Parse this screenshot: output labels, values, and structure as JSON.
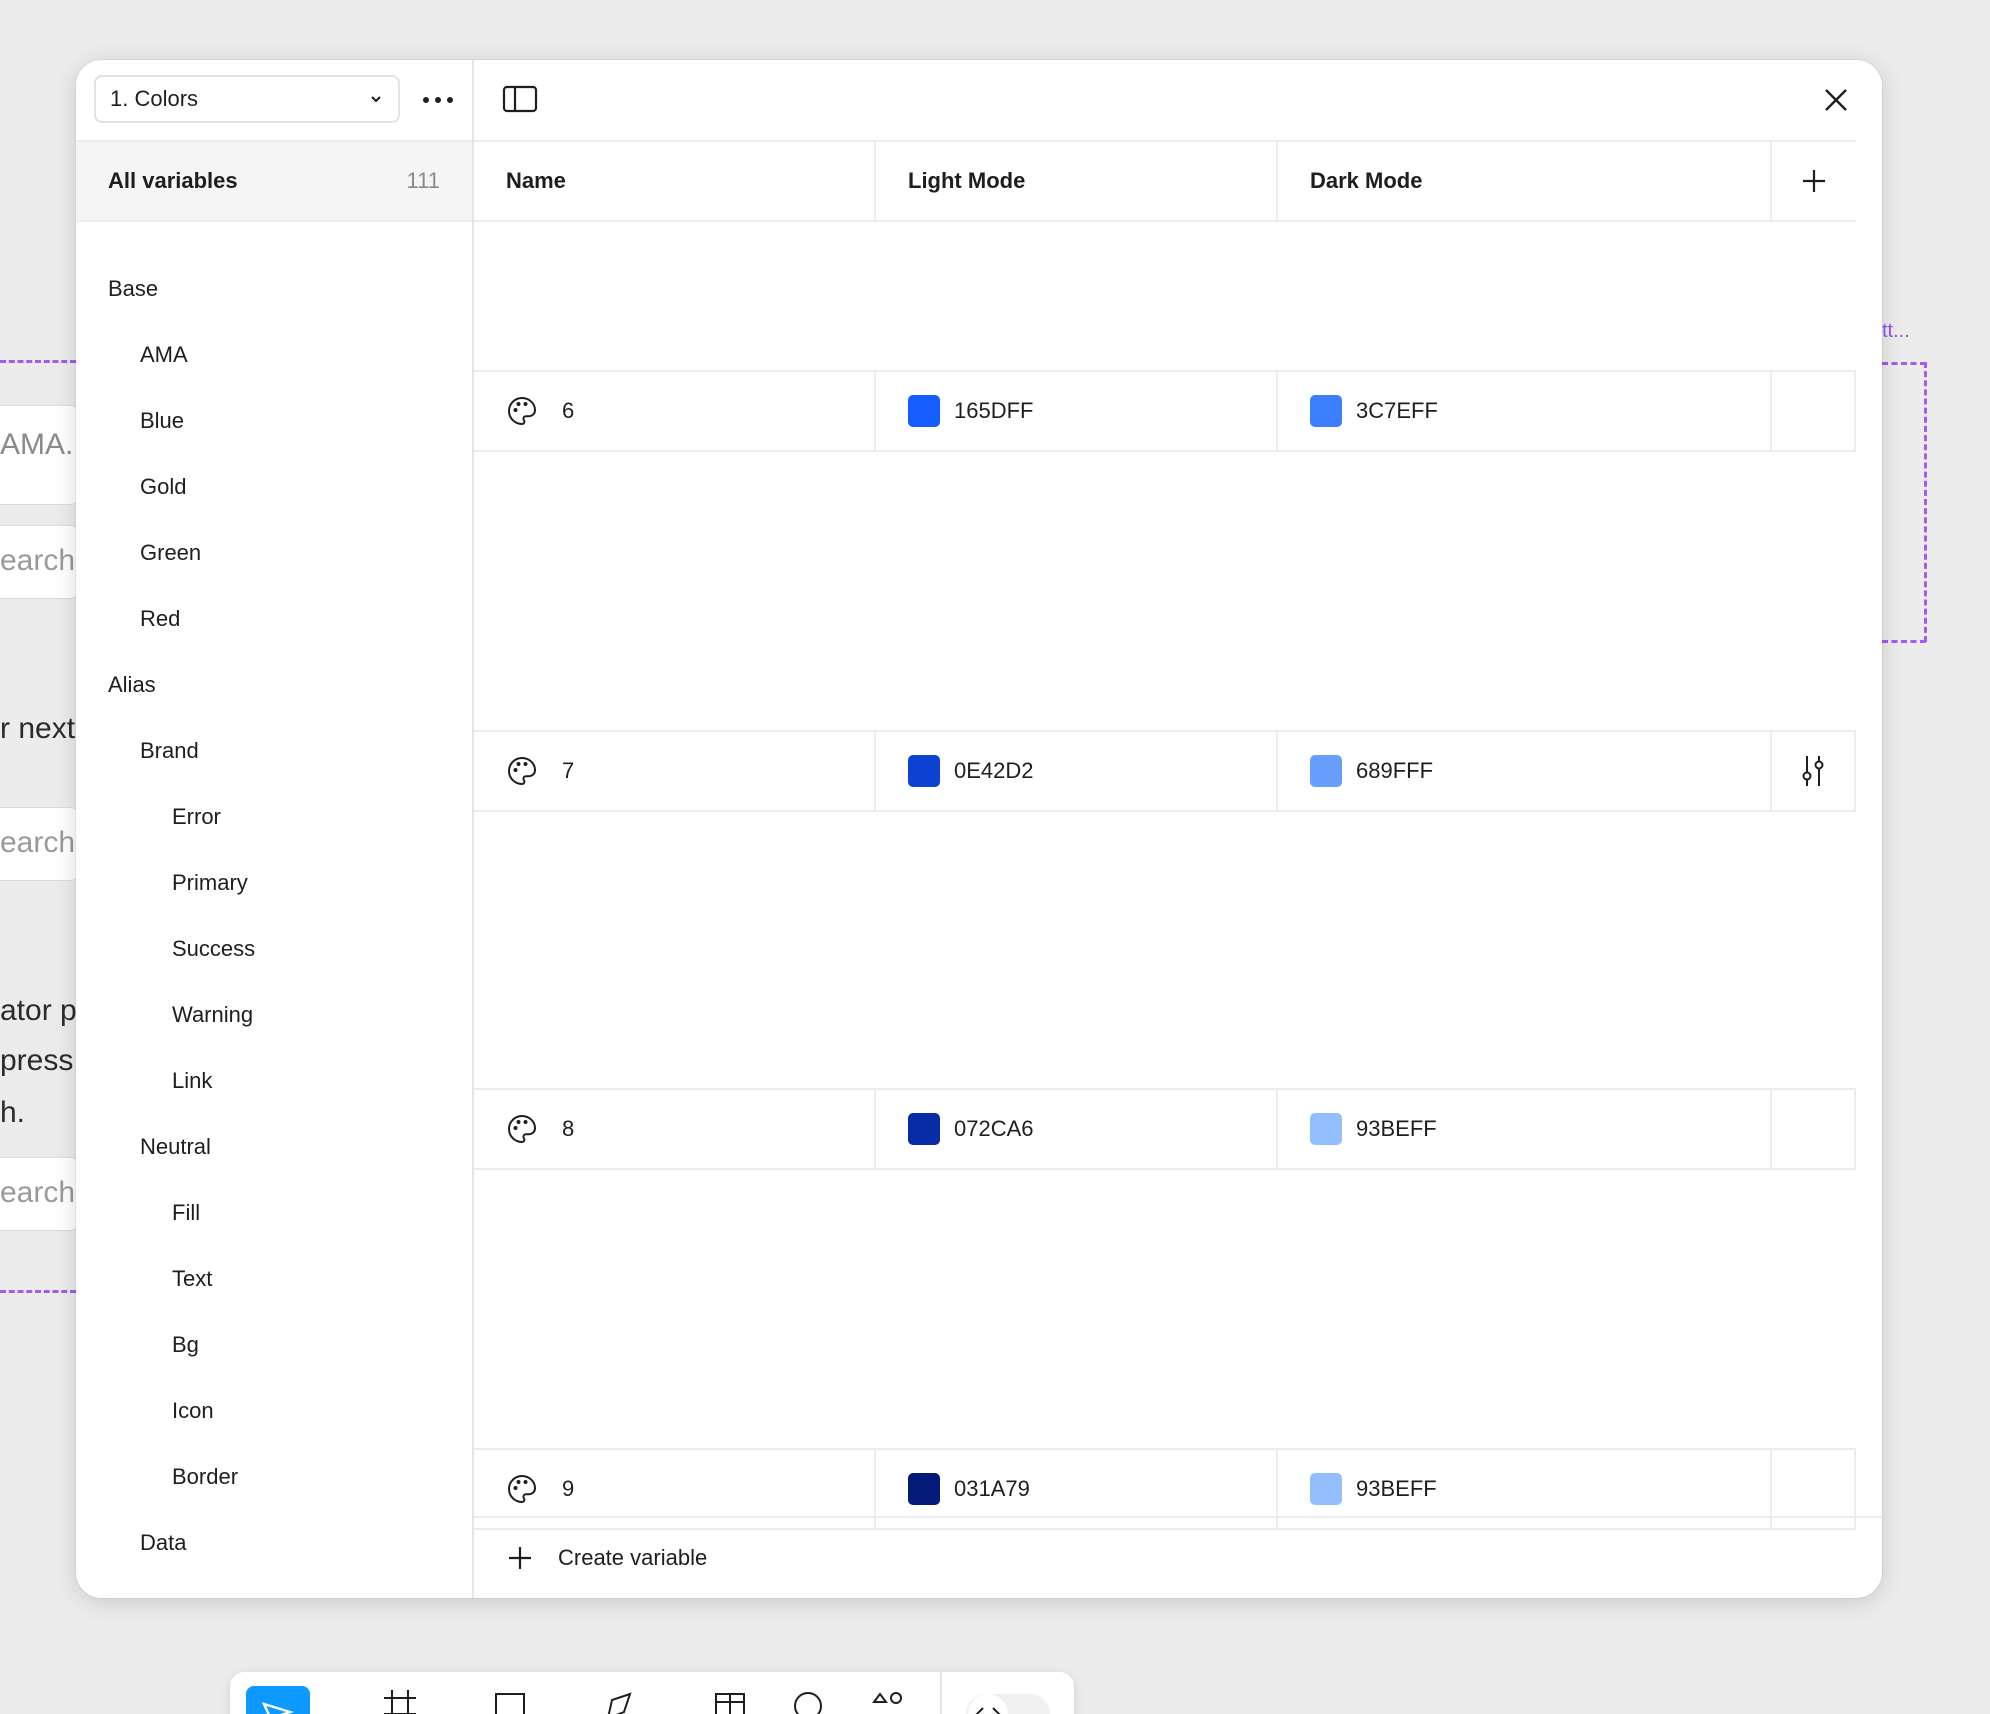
{
  "background": {
    "fragments": {
      "ama": "AMA...",
      "search1": "earch",
      "next": "r next",
      "search2": "earch",
      "ator": "ator p",
      "press": "press",
      "h": "h.",
      "search3": "earch",
      "purple_label": "tt..."
    }
  },
  "sidebar": {
    "collection": "1. Colors",
    "all_variables_label": "All variables",
    "all_variables_count": "111",
    "groups": [
      {
        "label": "Base",
        "level": 0
      },
      {
        "label": "AMA",
        "level": 1
      },
      {
        "label": "Blue",
        "level": 1
      },
      {
        "label": "Gold",
        "level": 1
      },
      {
        "label": "Green",
        "level": 1
      },
      {
        "label": "Red",
        "level": 1
      },
      {
        "label": "Alias",
        "level": 0
      },
      {
        "label": "Brand",
        "level": 1
      },
      {
        "label": "Error",
        "level": 2
      },
      {
        "label": "Primary",
        "level": 2
      },
      {
        "label": "Success",
        "level": 2
      },
      {
        "label": "Warning",
        "level": 2
      },
      {
        "label": "Link",
        "level": 2
      },
      {
        "label": "Neutral",
        "level": 1
      },
      {
        "label": "Fill",
        "level": 2
      },
      {
        "label": "Text",
        "level": 2
      },
      {
        "label": "Bg",
        "level": 2
      },
      {
        "label": "Icon",
        "level": 2
      },
      {
        "label": "Border",
        "level": 2
      },
      {
        "label": "Data",
        "level": 1
      }
    ]
  },
  "table": {
    "headers": {
      "name": "Name",
      "light": "Light Mode",
      "dark": "Dark Mode"
    },
    "rows": [
      {
        "name": "6",
        "light": "165DFF",
        "light_color": "#165DFF",
        "dark": "3C7EFF",
        "dark_color": "#3C7EFF"
      },
      {
        "name": "7",
        "light": "0E42D2",
        "light_color": "#0E42D2",
        "dark": "689FFF",
        "dark_color": "#689FFF"
      },
      {
        "name": "8",
        "light": "072CA6",
        "light_color": "#072CA6",
        "dark": "93BEFF",
        "dark_color": "#93BEFF"
      },
      {
        "name": "9",
        "light": "031A79",
        "light_color": "#031A79",
        "dark": "93BEFF",
        "dark_color": "#93BEFF"
      }
    ]
  },
  "footer": {
    "create_label": "Create variable"
  }
}
